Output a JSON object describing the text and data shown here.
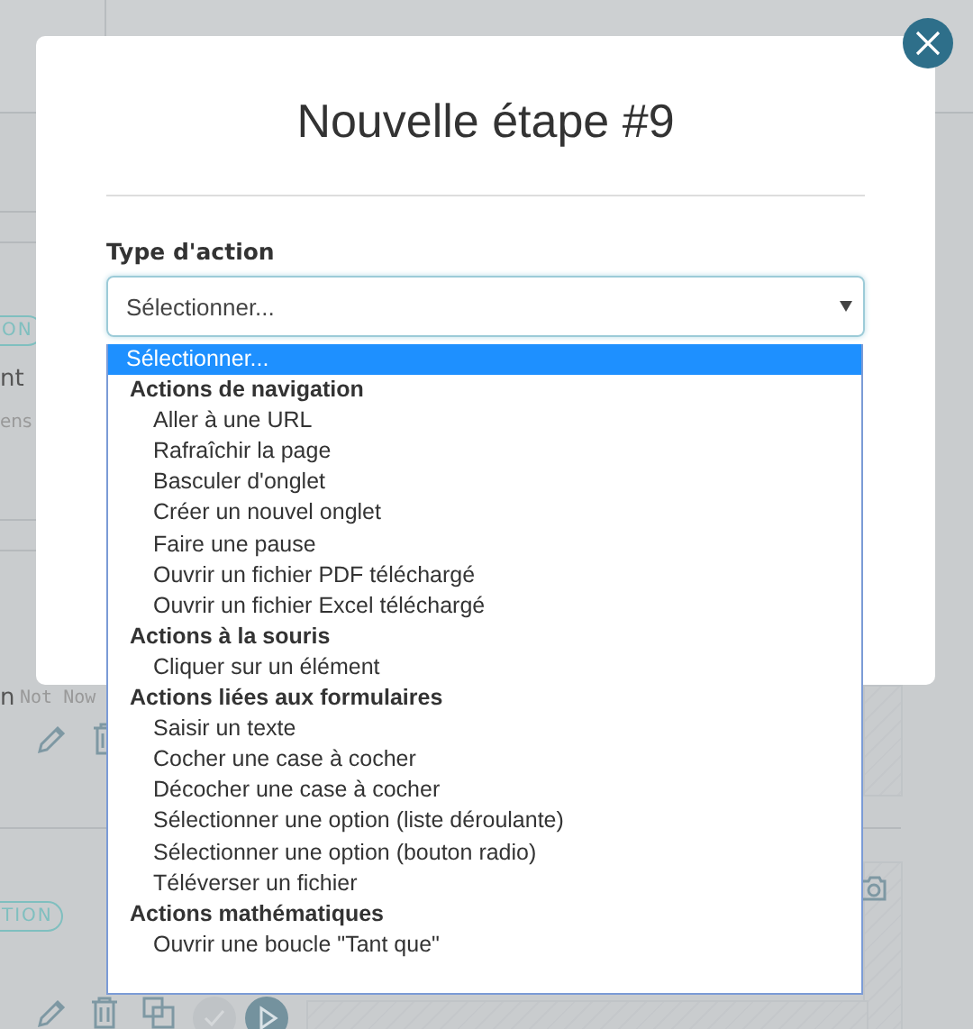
{
  "background": {
    "badges": [
      {
        "text": "ON"
      },
      {
        "text": "TION"
      }
    ],
    "texts": [
      {
        "text": "nt",
        "kind": "body"
      },
      {
        "text": "ens",
        "kind": "hint"
      },
      {
        "text": "n",
        "kind": "body"
      }
    ],
    "dismiss": "Not Now"
  },
  "modal": {
    "title": "Nouvelle étape #9",
    "field_label": "Type d'action",
    "select": {
      "value": "Sélectionner...",
      "expanded": true
    },
    "dropdown": {
      "options": [
        {
          "label": "Sélectionner...",
          "selected": true
        }
      ],
      "groups": [
        {
          "label": "Actions de navigation",
          "options": [
            {
              "label": "Aller à une URL",
              "selected": false
            },
            {
              "label": "Rafraîchir la page",
              "selected": false
            },
            {
              "label": "Basculer d'onglet",
              "selected": false
            },
            {
              "label": "Créer un nouvel onglet",
              "selected": false
            },
            {
              "label": "Faire une pause",
              "selected": false
            },
            {
              "label": "Ouvrir un fichier PDF téléchargé",
              "selected": false
            },
            {
              "label": "Ouvrir un fichier Excel téléchargé",
              "selected": false
            }
          ]
        },
        {
          "label": "Actions à la souris",
          "options": [
            {
              "label": "Cliquer sur un élément",
              "selected": false
            }
          ]
        },
        {
          "label": "Actions liées aux formulaires",
          "options": [
            {
              "label": "Saisir un texte",
              "selected": false
            },
            {
              "label": "Cocher une case à cocher",
              "selected": false
            },
            {
              "label": "Décocher une case à cocher",
              "selected": false
            },
            {
              "label": "Sélectionner une option (liste déroulante)",
              "selected": false
            },
            {
              "label": "Sélectionner une option (bouton radio)",
              "selected": false
            },
            {
              "label": "Téléverser un fichier",
              "selected": false
            }
          ]
        },
        {
          "label": "Actions mathématiques",
          "options": [
            {
              "label": "Ouvrir une boucle \"Tant que\"",
              "selected": false
            }
          ]
        }
      ]
    }
  }
}
